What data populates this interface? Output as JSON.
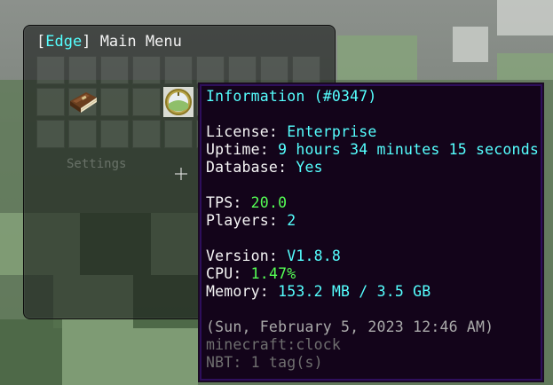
{
  "menu": {
    "title_bracket_open": "[",
    "title_tag": "Edge",
    "title_bracket_close": "]",
    "title_text": " Main Menu",
    "faded_label": "Settings"
  },
  "items": [
    {
      "icon": "book-icon",
      "name": "Book"
    },
    {
      "icon": "clock-icon",
      "name": "Clock"
    }
  ],
  "tooltip": {
    "title": "Information (#0347)",
    "license_label": "License: ",
    "license_value": "Enterprise",
    "uptime_label": "Uptime: ",
    "uptime_value": "9 hours 34 minutes 15 seconds",
    "database_label": "Database: ",
    "database_value": "Yes",
    "tps_label": "TPS: ",
    "tps_value": "20.0",
    "players_label": "Players: ",
    "players_value": "2",
    "version_label": "Version: ",
    "version_value": "V1.8.8",
    "cpu_label": "CPU: ",
    "cpu_value": "1.47%",
    "memory_label": "Memory: ",
    "memory_used": "153.2 MB",
    "memory_sep": " / ",
    "memory_total": "3.5 GB",
    "timestamp": "(Sun, February 5, 2023 12:46 AM)",
    "item_id": "minecraft:clock",
    "nbt": "NBT: 1 tag(s)"
  },
  "colors": {
    "aqua": "#55ffff",
    "green": "#55ff55",
    "gray": "#aaaaaa",
    "dark_gray": "#6f6f6f",
    "tooltip_bg": "#13041a",
    "tooltip_border": "#2e0f5c"
  }
}
